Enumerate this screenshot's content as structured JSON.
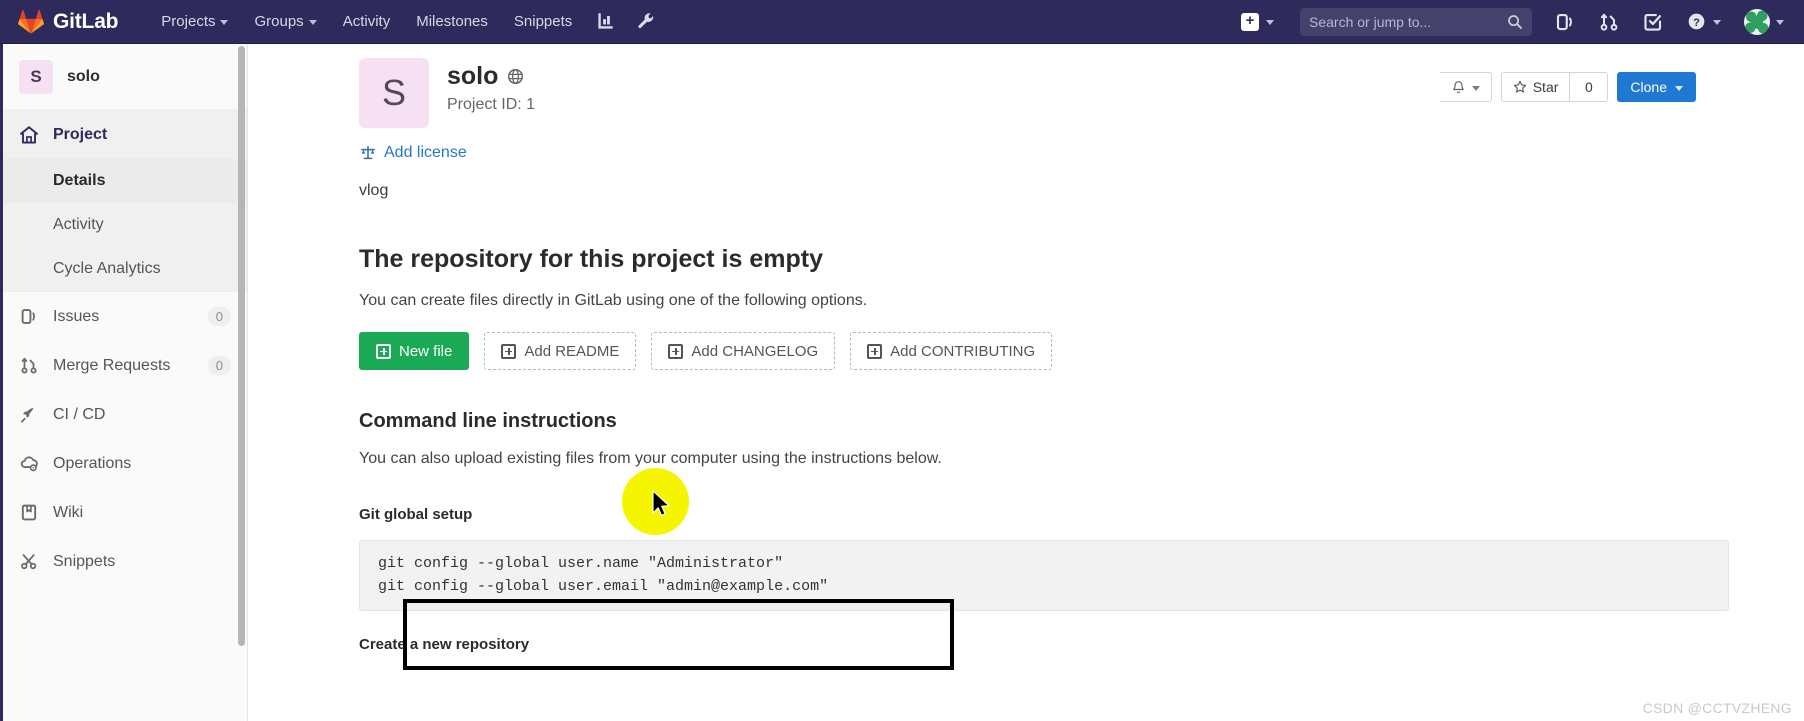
{
  "navbar": {
    "brand": "GitLab",
    "links": [
      {
        "label": "Projects",
        "has_caret": true,
        "icon": ""
      },
      {
        "label": "Groups",
        "has_caret": true,
        "icon": ""
      },
      {
        "label": "Activity",
        "has_caret": false,
        "icon": ""
      },
      {
        "label": "Milestones",
        "has_caret": false,
        "icon": ""
      },
      {
        "label": "Snippets",
        "has_caret": false,
        "icon": ""
      }
    ],
    "icon_buttons": [
      {
        "name": "analytics-icon"
      },
      {
        "name": "wrench-icon"
      }
    ],
    "create_new_label": "+",
    "search": {
      "placeholder": "Search or jump to...",
      "value": ""
    },
    "right_icons": [
      {
        "name": "issues-icon"
      },
      {
        "name": "merge-requests-icon"
      },
      {
        "name": "todos-icon"
      },
      {
        "name": "help-icon"
      }
    ],
    "colors": {
      "background": "#2e2a5b",
      "logo_orange": "#e24329"
    }
  },
  "sidebar": {
    "project_initial": "S",
    "project_name": "solo",
    "items": [
      {
        "label": "Project",
        "icon": "home-icon",
        "count": ""
      },
      {
        "label": "Issues",
        "icon": "issues-icon",
        "count": "0"
      },
      {
        "label": "Merge Requests",
        "icon": "merge-requests-icon",
        "count": "0"
      },
      {
        "label": "CI / CD",
        "icon": "rocket-icon",
        "count": ""
      },
      {
        "label": "Operations",
        "icon": "cloud-gear-icon",
        "count": ""
      },
      {
        "label": "Wiki",
        "icon": "book-icon",
        "count": ""
      },
      {
        "label": "Snippets",
        "icon": "scissors-icon",
        "count": ""
      }
    ],
    "sub_items": [
      {
        "label": "Details",
        "selected": true
      },
      {
        "label": "Activity",
        "selected": false
      },
      {
        "label": "Cycle Analytics",
        "selected": false
      }
    ]
  },
  "project": {
    "initial": "S",
    "name": "solo",
    "visibility_icon": "globe-icon",
    "id_label": "Project ID: 1",
    "add_license_label": "Add license",
    "description": "vlog"
  },
  "header_actions": {
    "notifications_icon": "bell-icon",
    "star_label": "Star",
    "star_count": "0",
    "clone_label": "Clone",
    "clone_color": "#1f78d1"
  },
  "empty_repo": {
    "title": "The repository for this project is empty",
    "subtitle": "You can create files directly in GitLab using one of the following options.",
    "buttons": [
      {
        "label": "New file",
        "primary": true
      },
      {
        "label": "Add README",
        "primary": false
      },
      {
        "label": "Add CHANGELOG",
        "primary": false
      },
      {
        "label": "Add CONTRIBUTING",
        "primary": false
      }
    ],
    "new_file_color": "#1aaa55"
  },
  "cli": {
    "title": "Command line instructions",
    "subtitle": "You can also upload existing files from your computer using the instructions below.",
    "git_global_setup_label": "Git global setup",
    "git_global_setup_lines": [
      "git config --global user.name \"Administrator\"",
      "git config --global user.email \"admin@example.com\""
    ],
    "create_new_repo_label": "Create a new repository"
  },
  "watermark": "CSDN @CCTVZHENG"
}
